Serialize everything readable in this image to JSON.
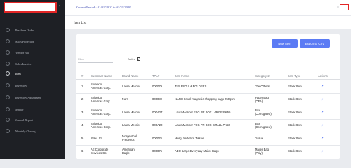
{
  "header": {
    "period": "Current Period : 01/01/2020 to 01/31/2020",
    "menu_icon": "hamburger-icon"
  },
  "sidebar": {
    "items": [
      {
        "label": "Purchase Order",
        "active": false
      },
      {
        "label": "Sales Projection",
        "active": false
      },
      {
        "label": "Vendor Bill",
        "active": false
      },
      {
        "label": "Sales Invoice",
        "active": false
      },
      {
        "label": "Item",
        "active": true
      },
      {
        "label": "Inventory",
        "active": false
      },
      {
        "label": "Inventory Adjustment",
        "active": false
      },
      {
        "label": "Master",
        "active": false
      },
      {
        "label": "Journal Report",
        "active": false
      },
      {
        "label": "Monthly Closing",
        "active": false
      }
    ]
  },
  "page": {
    "title": "Item List"
  },
  "toolbar": {
    "new_item": "New Item",
    "export": "Export to CSV"
  },
  "filters": {
    "filter_placeholder": "Filter",
    "active_label": "Active",
    "active_checked": true,
    "active_mark": "✓"
  },
  "table": {
    "columns": [
      "#",
      "Customer Name",
      "Brand Name",
      "TPA#",
      "Item Name",
      "Category-2",
      "Item Type",
      "Actions"
    ],
    "rows": [
      {
        "n": "1",
        "customer": [
          "Shiseido",
          "Americas Corp."
        ],
        "brand": [
          "Laura Mercier"
        ],
        "tpa": "000079",
        "item": "TLS FSG LM FOLDERS",
        "category": [
          "The Others"
        ],
        "type": "Stock Item"
      },
      {
        "n": "2",
        "customer": [
          "Shiseido",
          "Americas Corp."
        ],
        "brand": [
          "Nars"
        ],
        "tpa": "000080",
        "item": "NARS Small magnetic shopping bags 250gsm",
        "category": [
          "Paper Bag",
          "(OFA)"
        ],
        "type": "Stock Item"
      },
      {
        "n": "3",
        "customer": [
          "Shiseido",
          "Americas Corp."
        ],
        "brand": [
          "Laura Mercier"
        ],
        "tpa": "000A27",
        "item": "Laura Mercier FSG PR BOX LARGE PK50",
        "category": [
          "Box",
          "(Corrugated)"
        ],
        "type": "Stock Item"
      },
      {
        "n": "4",
        "customer": [
          "Shiseido",
          "Americas Corp."
        ],
        "brand": [
          "Laura Mercier"
        ],
        "tpa": "000A20",
        "item": "Laura Mercier FSG PR BOX SMALL PK50",
        "category": [
          "Box",
          "(Corrugated)"
        ],
        "type": "Stock Item"
      },
      {
        "n": "5",
        "customer": [
          "Robi Ltd"
        ],
        "brand": [
          "Morgenthal",
          "Frederics"
        ],
        "tpa": "000076",
        "item": "Morg Frederics Tissue",
        "category": [
          "Tissue"
        ],
        "type": "Stock Item"
      },
      {
        "n": "6",
        "customer": [
          "AE Corporate",
          "Services Co."
        ],
        "brand": [
          "American",
          "Eagle"
        ],
        "tpa": "000075",
        "item": "AEO Large Everyday Mailer Bags",
        "category": [
          "Mailer Bag",
          "(Poly)"
        ],
        "type": "Stock Item"
      }
    ]
  },
  "colors": {
    "accent": "#5b7bf4",
    "sidebar_bg": "#1e2025",
    "period_text": "#3f4bb3",
    "highlight_box": "#e32626"
  }
}
